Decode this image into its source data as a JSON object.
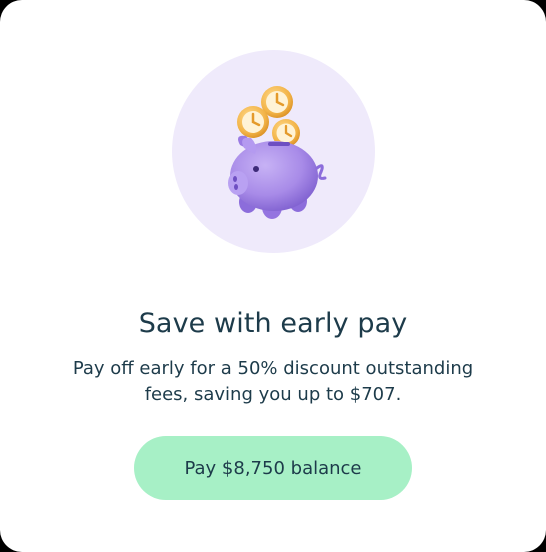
{
  "card": {
    "title": "Save with early pay",
    "description": "Pay off early for a 50% discount outstanding fees, saving you up to $707.",
    "pay_button_label": "Pay $8,750 balance"
  },
  "illustration": {
    "icon": "piggy-bank-with-clock-coins-icon"
  },
  "colors": {
    "circle_background": "#efeafb",
    "piggy": "#a98ee8",
    "coin": "#f4b74a",
    "button": "#a7f0c6",
    "text": "#1d3b4a"
  }
}
